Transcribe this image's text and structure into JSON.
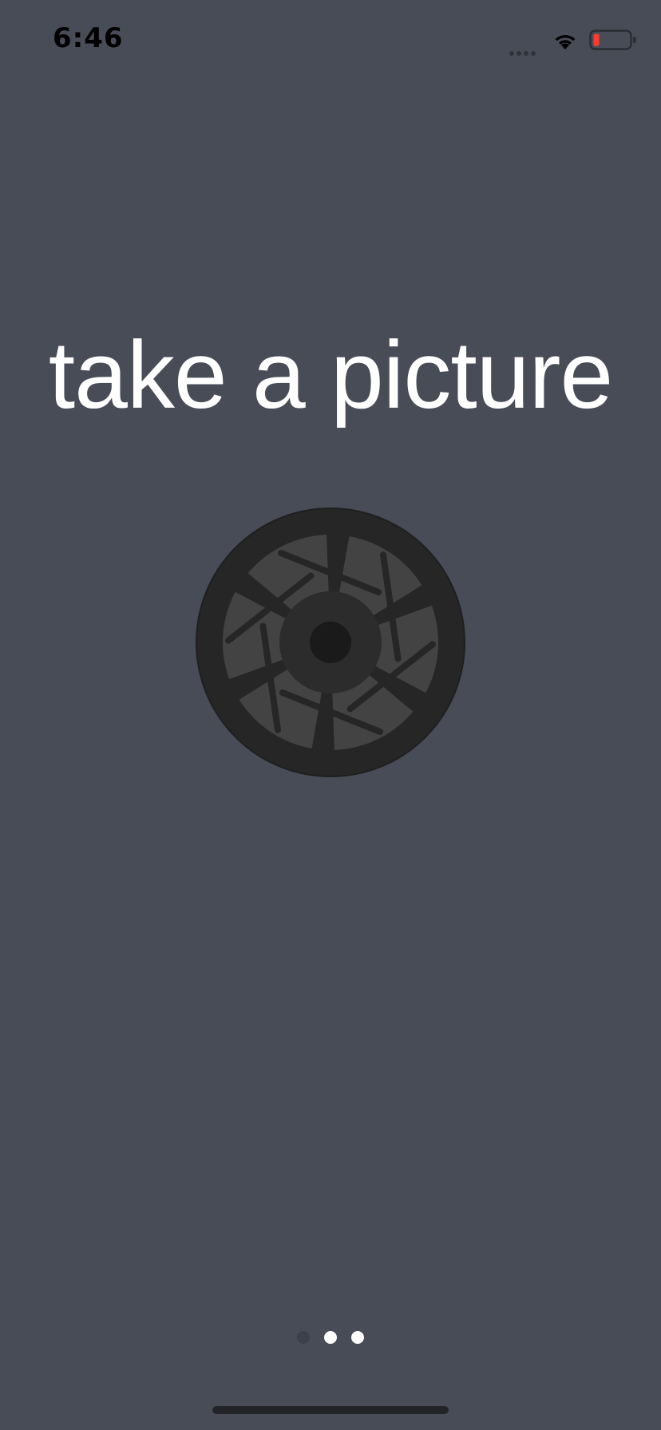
{
  "status_bar": {
    "time": "6:46",
    "icons": [
      "signal-dots-icon",
      "wifi-icon",
      "battery-low-icon"
    ],
    "battery_color": "#ff3b30"
  },
  "onboarding": {
    "title": "take a picture",
    "icon": "camera-aperture-icon"
  },
  "page_control": {
    "count": 3,
    "current_index": 0
  },
  "colors": {
    "background": "#474c57",
    "text": "#ffffff",
    "aperture_dark": "#262626",
    "aperture_blade": "#434343"
  }
}
